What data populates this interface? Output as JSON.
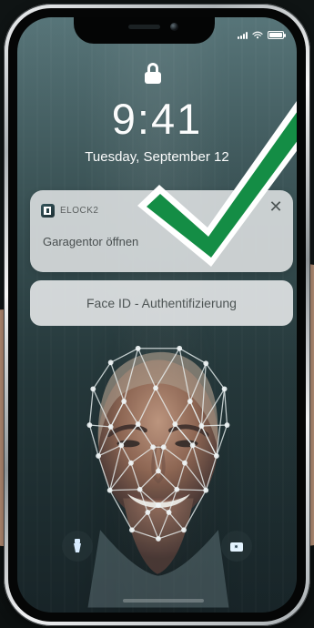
{
  "lock_screen": {
    "time": "9:41",
    "date": "Tuesday, September 12"
  },
  "notification": {
    "app_name": "ELOCK2",
    "message": "Garagentor öffnen",
    "close_label": "✕"
  },
  "authentication": {
    "label": "Face ID - Authentifizierung"
  },
  "icons": {
    "lock": "lock-icon",
    "signal": "signal-icon",
    "wifi": "wifi-icon",
    "battery": "battery-icon",
    "close": "close-icon",
    "app": "elock-app-icon",
    "checkmark": "checkmark-icon",
    "flashlight": "flashlight-icon",
    "camera": "camera-icon"
  },
  "colors": {
    "checkmark_green": "#148d45",
    "checkmark_outline": "#ffffff",
    "notification_bg": "#dadedf",
    "faceid_bg": "#e4e7e8"
  }
}
